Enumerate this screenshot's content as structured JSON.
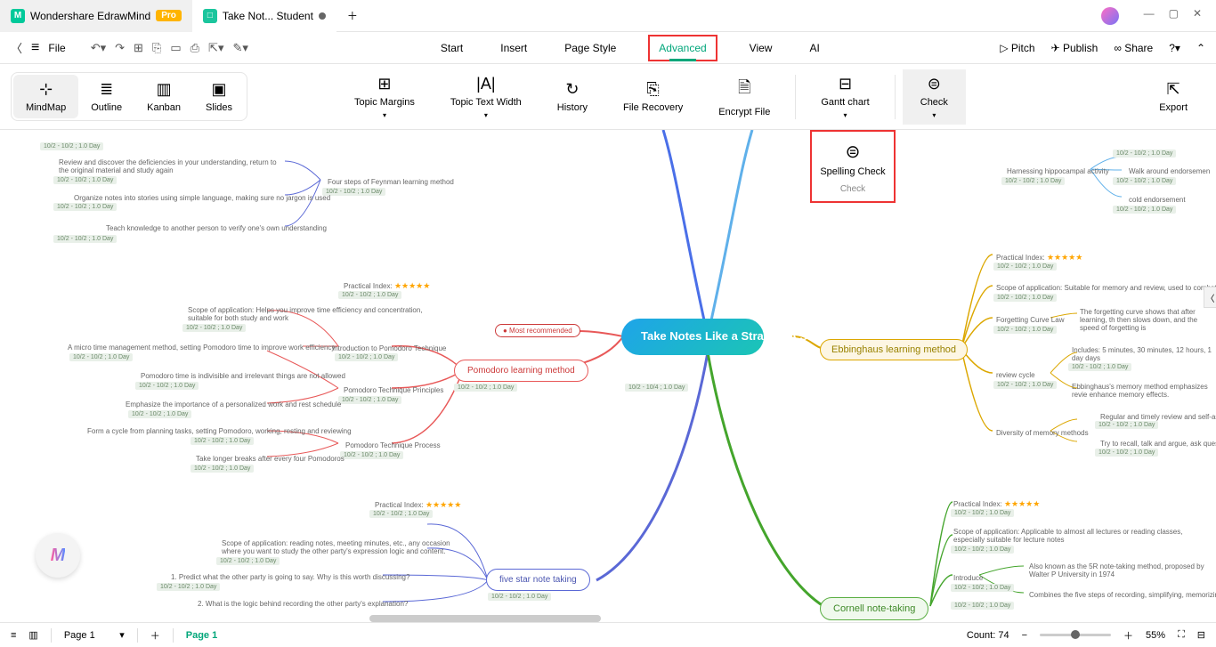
{
  "titlebar": {
    "app_name": "Wondershare EdrawMind",
    "pro_badge": "Pro",
    "doc_tab": "Take Not... Student"
  },
  "menubar": {
    "file": "File",
    "tabs": [
      "Start",
      "Insert",
      "Page Style",
      "Advanced",
      "View",
      "AI"
    ],
    "active_tab": "Advanced",
    "right": {
      "pitch": "Pitch",
      "publish": "Publish",
      "share": "Share"
    }
  },
  "toolbar": {
    "views": {
      "mindmap": "MindMap",
      "outline": "Outline",
      "kanban": "Kanban",
      "slides": "Slides"
    },
    "advanced": {
      "topic_margins": "Topic Margins",
      "topic_text_width": "Topic Text Width",
      "history": "History",
      "file_recovery": "File Recovery",
      "encrypt_file": "Encrypt File",
      "gantt_chart": "Gantt chart",
      "check": "Check",
      "export": "Export"
    }
  },
  "check_popup": {
    "label": "Spelling Check",
    "sub": "Check"
  },
  "mindmap": {
    "central": "Take Notes Like a\nStraight-A Student",
    "central_date": "10/2 - 10/4 ; 1.0 Day",
    "most_recommended": "● Most recommended",
    "date_generic": "10/2 - 10/2 ; 1.0 Day",
    "feynman": {
      "title": "Four steps of Feynman learning method",
      "n1": "Review and discover the deficiencies in your understanding, return to the original material and study again",
      "n2": "Organize notes into stories using simple language, making sure no jargon is used",
      "n3": "Teach knowledge to another person to verify one's own understanding"
    },
    "pomodoro": {
      "practical_index": "Practical Index:",
      "title": "Pomodoro learning method",
      "intro": "Introduction to Pomodoro Technique",
      "principles": "Pomodoro Technique Principles",
      "process": "Pomodoro Technique Process",
      "scope": "Scope of application: Helps you improve time efficiency and concentration, suitable for both study and work",
      "micro": "A micro time management method, setting Pomodoro time to improve work efficiency",
      "indivisible": "Pomodoro time is indivisible and irrelevant things are not allowed",
      "emphasize": "Emphasize the importance of a personalized work and rest schedule",
      "cycle": "Form a cycle from planning tasks, setting Pomodoro, working, resting and reviewing",
      "breaks": "Take longer breaks after every four Pomodoros"
    },
    "fivestar": {
      "title": "five star note taking",
      "practical_index": "Practical Index:",
      "scope": "Scope of application: reading notes, meeting minutes, etc., any occasion where you want to study the other party's expression logic and content.",
      "q1": "1. Predict what the other party is going to say. Why is this worth discussing?",
      "q2": "2. What is the logic behind recording the other party's explanation?"
    },
    "ebbinghaus": {
      "title": "Ebbinghaus learning method",
      "practical_index": "Practical Index:",
      "scope": "Scope of application: Suitable for memory and review, used to combat forgetti",
      "curve_law": "Forgetting Curve Law",
      "review_cycle": "review cycle",
      "diversity": "Diversity of memory methods",
      "curve_desc": "The forgetting curve shows that after learning, th then slows down, and the speed of forgetting is",
      "includes": "Includes: 5 minutes, 30 minutes, 12 hours, 1 day days",
      "emphasizes": "Ebbinghaus's memory method emphasizes revie enhance memory effects.",
      "regular": "Regular and timely review and self-asse",
      "recall": "Try to recall, talk and argue, ask questi"
    },
    "hippocampal": {
      "harness": "Harnessing hippocampal activity",
      "walk": "Walk around endorsemen",
      "cold": "cold endorsement"
    },
    "cornell": {
      "title": "Cornell note-taking",
      "practical_index": "Practical Index:",
      "scope": "Scope of application: Applicable to almost all lectures or reading classes, especially suitable for lecture notes",
      "introduce": "Introduce",
      "also": "Also known as the 5R note-taking method, proposed by Walter P University in 1974",
      "combines": "Combines the five steps of recording, simplifying, memorizing, thi"
    }
  },
  "statusbar": {
    "page_select": "Page 1",
    "page_active": "Page 1",
    "count_label": "Count:",
    "count_value": "74",
    "zoom": "55%"
  }
}
